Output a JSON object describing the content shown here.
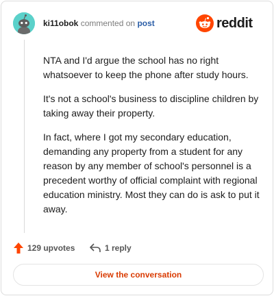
{
  "header": {
    "username": "ki11obok",
    "action": "commented on",
    "post_link": "post",
    "brand": "reddit"
  },
  "comment": {
    "paragraphs": [
      "NTA and I'd argue the school has no right whatsoever to keep the phone after study hours.",
      "It's not a school's business to discipline children by taking away their property.",
      "In fact, where I got my secondary education, demanding any property from a student for any reason by any member of school's personnel is a precedent worthy of official complaint with regional education ministry. Most they can do is ask to put it away."
    ]
  },
  "actions": {
    "upvotes": "129 upvotes",
    "replies": "1 reply"
  },
  "footer": {
    "view_label": "View the conversation"
  },
  "colors": {
    "brand_orange": "#ff4500",
    "link_blue": "#2b5ea7",
    "button_text": "#d93a00",
    "avatar_bg": "#5bd1ca"
  },
  "icons": {
    "avatar": "snoo-avatar",
    "brand": "reddit-logo-icon",
    "upvote": "upvote-arrow-icon",
    "reply": "reply-arrow-icon"
  }
}
